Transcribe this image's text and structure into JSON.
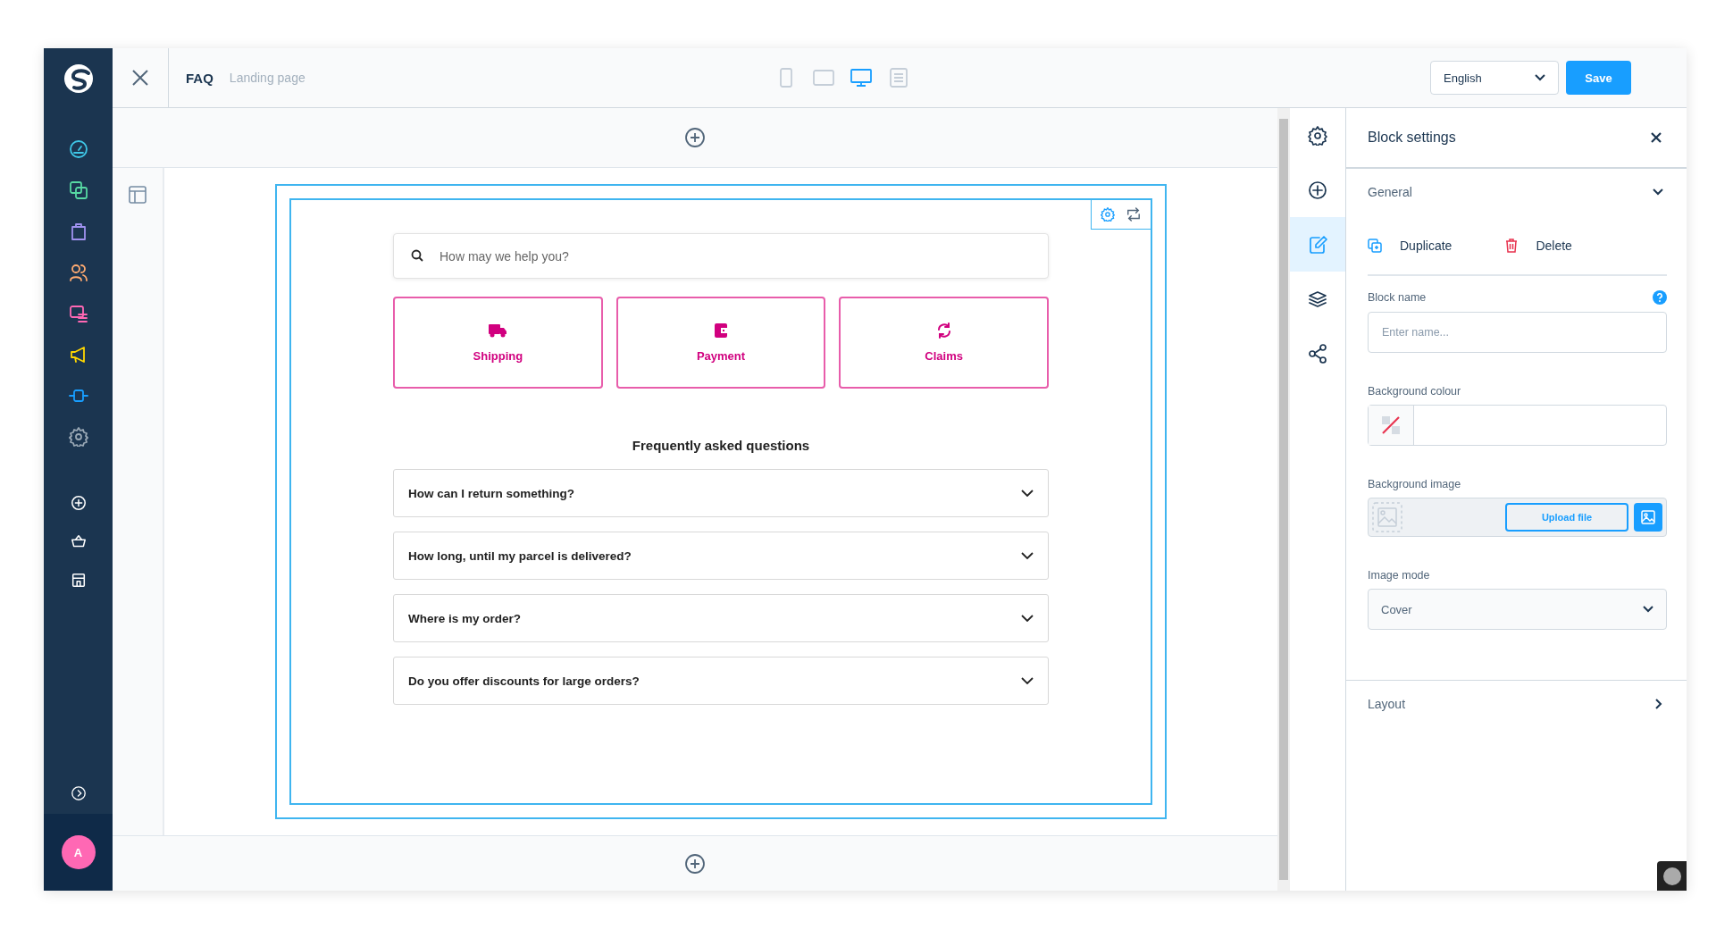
{
  "app_sidebar": {
    "nav_items": [
      {
        "kind": "dashboard",
        "color": "#3fc8e8"
      },
      {
        "kind": "catalog",
        "color": "#57d9a3"
      },
      {
        "kind": "orders",
        "color": "#a092f0"
      },
      {
        "kind": "customers",
        "color": "#ffab71"
      },
      {
        "kind": "content",
        "color": "#ff68b4"
      },
      {
        "kind": "marketing",
        "color": "#ffd700"
      },
      {
        "kind": "extensions",
        "color": "#189eff"
      },
      {
        "kind": "settings",
        "color": "#9aa8b5"
      }
    ],
    "shortcut_items": [
      {
        "kind": "add"
      },
      {
        "kind": "basket"
      },
      {
        "kind": "store"
      }
    ],
    "avatar": "A"
  },
  "toolbar": {
    "title": "FAQ",
    "subtitle": "Landing page",
    "devices": [
      {
        "kind": "mobile",
        "selected": false
      },
      {
        "kind": "tablet",
        "selected": false
      },
      {
        "kind": "desktop",
        "selected": true
      },
      {
        "kind": "form",
        "selected": false
      }
    ],
    "language": "English",
    "save": "Save"
  },
  "block": {
    "search_placeholder": "How may we help you?",
    "categories": [
      {
        "kind": "truck",
        "label": "Shipping"
      },
      {
        "kind": "wallet",
        "label": "Payment"
      },
      {
        "kind": "refresh",
        "label": "Claims"
      }
    ],
    "heading": "Frequently asked questions",
    "questions": [
      {
        "text": "How can I return something?",
        "expanded": false
      },
      {
        "text": "How long, until my parcel is delivered?",
        "expanded": false
      },
      {
        "text": "Where is my order?",
        "expanded": false
      },
      {
        "text": "Do you offer discounts for large orders?",
        "expanded": false
      }
    ]
  },
  "sidebar_tabs": [
    {
      "kind": "settings",
      "selected": false
    },
    {
      "kind": "add",
      "selected": false
    },
    {
      "kind": "edit",
      "selected": true
    },
    {
      "kind": "layers",
      "selected": false
    },
    {
      "kind": "share",
      "selected": false
    }
  ],
  "panel": {
    "title": "Block settings",
    "general": {
      "title": "General",
      "expanded": true,
      "duplicate": "Duplicate",
      "delete": "Delete",
      "block_name_label": "Block name",
      "block_name_placeholder": "Enter name...",
      "background_colour_label": "Background colour",
      "background_image_label": "Background image",
      "upload": "Upload file",
      "image_mode_label": "Image mode",
      "image_mode": "Cover"
    },
    "layout": {
      "title": "Layout",
      "expanded": false
    }
  }
}
